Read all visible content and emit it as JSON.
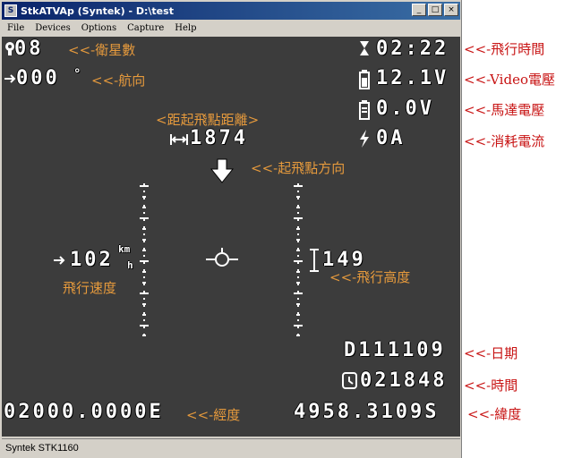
{
  "window": {
    "title": "StkATVAp (Syntek) - D:\\test",
    "buttons": [
      "_",
      "□",
      "×"
    ]
  },
  "menu": [
    "File",
    "Devices",
    "Options",
    "Capture",
    "Help"
  ],
  "osd": {
    "satellites": "08",
    "heading": "000",
    "heading_unit": "°",
    "flight_time": "02:22",
    "video_voltage": "12.1V",
    "motor_voltage": "0.0V",
    "current": "0A",
    "distance": "1874",
    "speed": "102",
    "speed_unit_top": "km",
    "speed_unit_bottom": "h",
    "altitude": "149",
    "date": "D111109",
    "time": "021848",
    "longitude": "02000.0000E",
    "latitude": "4958.3109S"
  },
  "annotations": {
    "satellites": "<<-衛星數",
    "heading": "<<-航向",
    "distance": "<距起飛點距離>",
    "home_direction": "<<-起飛點方向",
    "speed": "飛行速度",
    "altitude": "<<-飛行高度",
    "longitude": "<<-經度",
    "flight_time": "<<-飛行時間",
    "video_voltage": "<<-Video電壓",
    "motor_voltage": "<<-馬達電壓",
    "current": "<<-消耗電流",
    "date": "<<-日期",
    "time": "<<-時間",
    "latitude": "<<-緯度"
  },
  "status": "Syntek STK1160",
  "colors": {
    "annotation_inside": "#e69a3c",
    "annotation_outside": "#c81414",
    "title_bar": "#0a246a",
    "video_bg": "#3c3c3c"
  }
}
